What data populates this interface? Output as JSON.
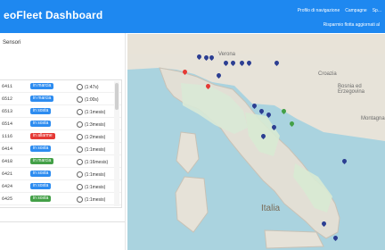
{
  "header": {
    "brand": "eoFleet Dashboard",
    "nav": [
      "Profilo di navigazione",
      "Campagne",
      "Sp..."
    ],
    "subnav": "Risparmio flotta aggiornati al"
  },
  "left_panel": {
    "title": "Sensori",
    "list": [
      {
        "id": "6411",
        "badge": "in marcia",
        "badge_color": "#2d8cf0",
        "time": "(1:47s)"
      },
      {
        "id": "6512",
        "badge": "in marcia",
        "badge_color": "#2d8cf0",
        "time": "(1:00s)"
      },
      {
        "id": "6513",
        "badge": "in sosta",
        "badge_color": "#2d8cf0",
        "time": "(1:1mesis)"
      },
      {
        "id": "6514",
        "badge": "in sosta",
        "badge_color": "#2d8cf0",
        "time": "(1:3mesis)"
      },
      {
        "id": "1116",
        "badge": "in allarme",
        "badge_color": "#e53935",
        "time": "(1:2mesis)"
      },
      {
        "id": "6414",
        "badge": "in sosta",
        "badge_color": "#2d8cf0",
        "time": "(1:1mesis)"
      },
      {
        "id": "6418",
        "badge": "in marcia",
        "badge_color": "#43a047",
        "time": "(1:16mesis)"
      },
      {
        "id": "6421",
        "badge": "in sosta",
        "badge_color": "#2d8cf0",
        "time": "(1:1mesis)"
      },
      {
        "id": "6424",
        "badge": "in sosta",
        "badge_color": "#2d8cf0",
        "time": "(1:1mesis)"
      },
      {
        "id": "6425",
        "badge": "in sosta",
        "badge_color": "#43a047",
        "time": "(1:1mesis)"
      }
    ]
  },
  "map": {
    "labels": {
      "verona": "Verona",
      "croazia": "Croazia",
      "bosnia": "Bosnia ed Erzegovina",
      "montagna": "Montagna",
      "italia": "Italia"
    }
  }
}
